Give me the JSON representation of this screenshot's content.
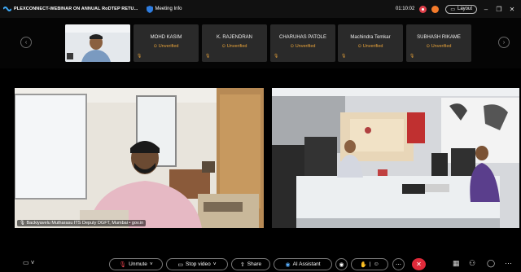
{
  "titlebar": {
    "title": "PLEXCONNECT-WEBINAR ON ANNUAL RoDTEP RETU...",
    "meeting_info": "Meeting Info",
    "timer": "01:10:02",
    "layout_label": "Layout",
    "colors": {
      "record": "#e0404b",
      "alert": "#f47b2b"
    }
  },
  "participants": [
    {
      "name": "MOHD KASIM",
      "status": "Unverified"
    },
    {
      "name": "K. RAJENDRAN",
      "status": "Unverified"
    },
    {
      "name": "CHARUHAS PATOLE",
      "status": "Unverified"
    },
    {
      "name": "Machindra Temkar",
      "status": "Unverified"
    },
    {
      "name": "SUBHASH RIKAME",
      "status": "Unverified"
    }
  ],
  "video": {
    "left_name": "Backiyavelu Mutharasu ITS Deputy DGFT, Mumbai • gov.in"
  },
  "controls": {
    "unmute": "Unmute",
    "stop_video": "Stop video",
    "share": "Share",
    "ai_assistant": "AI Assistant",
    "end_color": "#e02a3a"
  }
}
